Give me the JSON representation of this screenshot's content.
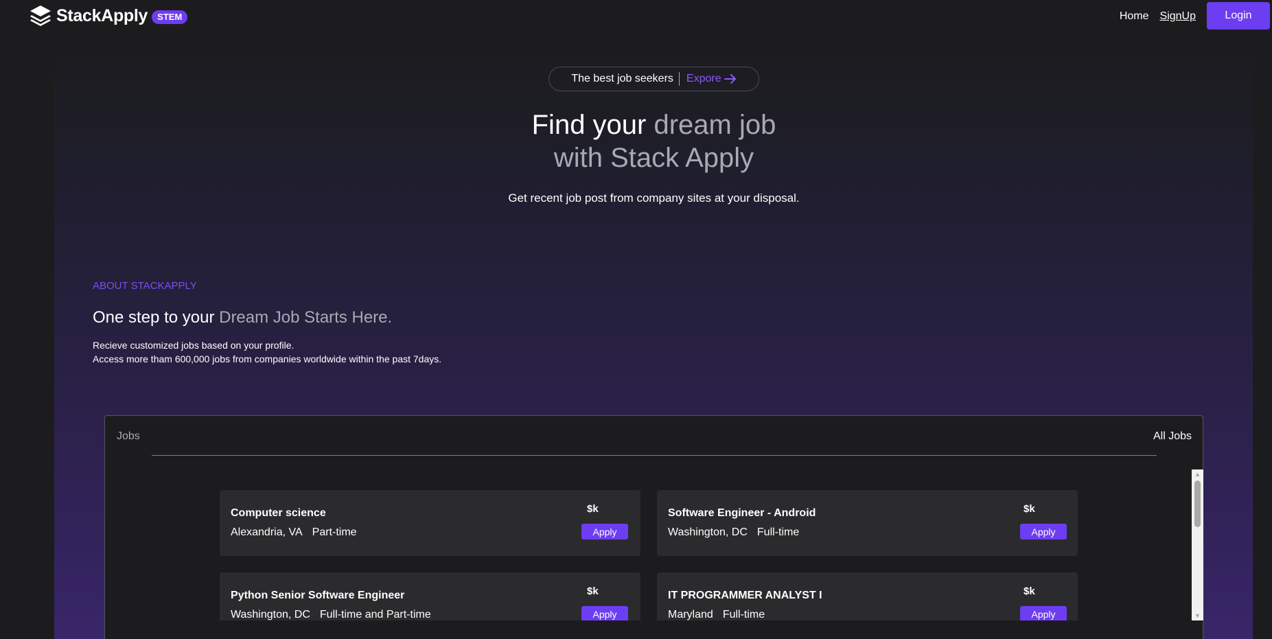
{
  "nav": {
    "brand": "StackApply",
    "badge": "STEM",
    "home": "Home",
    "signup": "SignUp",
    "login": "Login"
  },
  "hero": {
    "pill_text": "The best job seekers",
    "pill_link": "Expore",
    "title_part1": "Find your ",
    "title_part2": "dream job",
    "title_line2": "with Stack Apply",
    "subtitle": "Get recent job post from company sites at your disposal."
  },
  "about": {
    "label": "ABOUT STACKAPPLY",
    "title_part1": "One step to your ",
    "title_part2": "Dream Job Starts Here.",
    "line1": "Recieve customized jobs based on your profile.",
    "line2": "Access more tham 600,000 jobs from companies worldwide within the past 7days."
  },
  "jobs": {
    "tab_label": "Jobs",
    "all_jobs": "All Jobs",
    "items": [
      {
        "title": "Computer science",
        "location": "Alexandria, VA",
        "type": "Part-time",
        "salary": "$k",
        "apply": "Apply"
      },
      {
        "title": "Software Engineer - Android",
        "location": "Washington, DC",
        "type": "Full-time",
        "salary": "$k",
        "apply": "Apply"
      },
      {
        "title": "Python Senior Software Engineer",
        "location": "Washington, DC",
        "type": "Full-time and Part-time",
        "salary": "$k",
        "apply": "Apply"
      },
      {
        "title": "IT PROGRAMMER ANALYST I",
        "location": "Maryland",
        "type": "Full-time",
        "salary": "$k",
        "apply": "Apply"
      }
    ]
  },
  "icons": {
    "logo": "layers-icon",
    "explore": "arrow-right-icon",
    "scroll_up": "triangle-up-icon",
    "scroll_down": "triangle-down-icon"
  },
  "colors": {
    "accent": "#6d3df2",
    "background": "#1c1c1e",
    "card": "#2b2b2d"
  }
}
